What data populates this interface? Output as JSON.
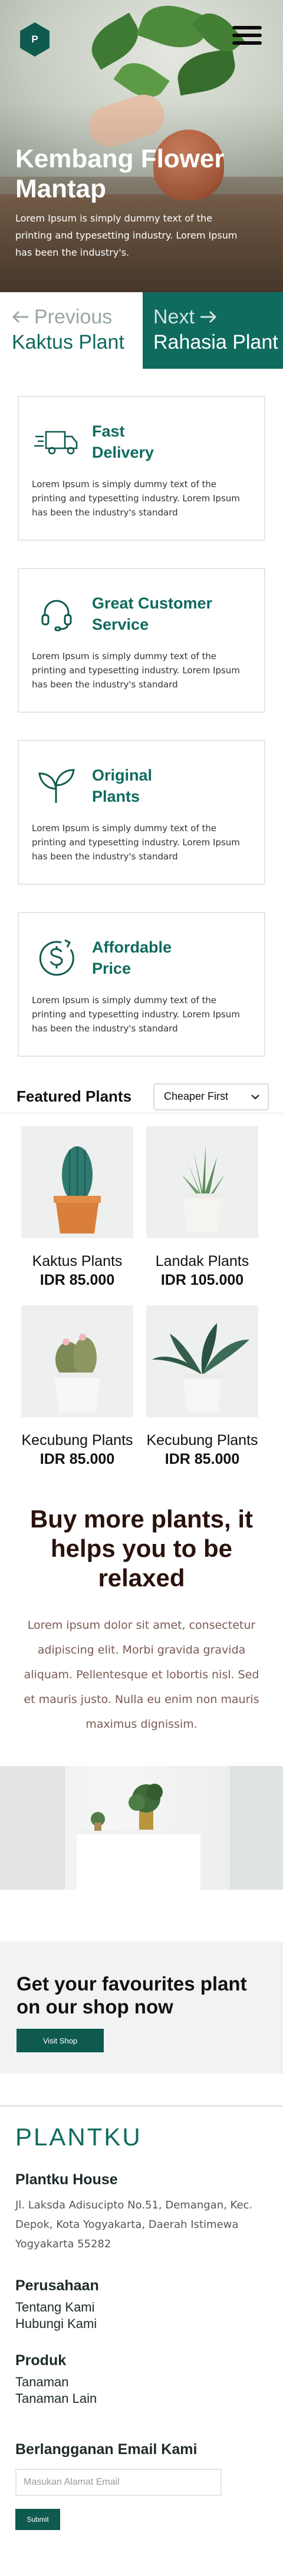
{
  "header": {
    "logo_letter": "P",
    "hero_title": "Kembang Flower Mantap",
    "hero_description": "Lorem Ipsum is simply dummy text of the printing and typesetting industry. Lorem Ipsum has been the industry's."
  },
  "pagination": {
    "prev_label": "Previous",
    "prev_title": "Kaktus Plant",
    "next_label": "Next",
    "next_title": "Rahasia Plant",
    "prev_icon": "arrow-left-icon",
    "next_icon": "arrow-right-icon"
  },
  "features": [
    {
      "icon": "delivery-truck-icon",
      "title_line1": "Fast",
      "title_line2": "Delivery",
      "text": "Lorem Ipsum is simply dummy text of the printing and typesetting industry. Lorem Ipsum has been the industry's standard"
    },
    {
      "icon": "headset-icon",
      "title_line1": "Great Customer",
      "title_line2": "Service",
      "text": "Lorem Ipsum is simply dummy text of the printing and typesetting industry. Lorem Ipsum has been the industry's standard"
    },
    {
      "icon": "plant-leaves-icon",
      "title_line1": "Original",
      "title_line2": "Plants",
      "text": "Lorem Ipsum is simply dummy text of the printing and typesetting industry. Lorem Ipsum has been the industry's standard"
    },
    {
      "icon": "dollar-badge-icon",
      "title_line1": "Affordable",
      "title_line2": "Price",
      "text": "Lorem Ipsum is simply dummy text of the printing and typesetting industry. Lorem Ipsum has been the industry's standard"
    }
  ],
  "featured": {
    "title": "Featured Plants",
    "sort_selected": "Cheaper First",
    "products": [
      {
        "name": "Kaktus Plants",
        "price": "IDR 85.000"
      },
      {
        "name": "Landak Plants",
        "price": "IDR 105.000"
      },
      {
        "name": "Kecubung Plants",
        "price": "IDR 85.000"
      },
      {
        "name": "Kecubung Plants",
        "price": "IDR 85.000"
      }
    ]
  },
  "promo": {
    "title": "Buy more plants, it helps you to be relaxed",
    "text": "Lorem ipsum dolor sit amet, consectetur adipiscing elit. Morbi gravida gravida aliquam. Pellentesque et lobortis nisl. Sed et mauris justo. Nulla eu enim non mauris maximus dignissim."
  },
  "cta": {
    "title": "Get your favourites plant on our shop now",
    "button": "Visit Shop"
  },
  "footer": {
    "brand": "PLANTKU",
    "house_title": "Plantku House",
    "address": "Jl. Laksda Adisucipto No.51, Demangan, Kec. Depok, Kota Yogyakarta, Daerah Istimewa Yogyakarta 55282",
    "company_title": "Perusahaan",
    "company_links": [
      "Tentang Kami",
      "Hubungi Kami"
    ],
    "product_title": "Produk",
    "product_links": [
      "Tanaman",
      "Tanaman Lain"
    ],
    "subscribe_title": "Berlangganan Email Kami",
    "email_placeholder": "Masukan Alamat Email",
    "submit": "Submit"
  },
  "colors": {
    "primary": "#0f6b5e",
    "primary_dark": "#0f5a4f",
    "promo_title": "#2a120c",
    "promo_text": "#7a5a52"
  }
}
